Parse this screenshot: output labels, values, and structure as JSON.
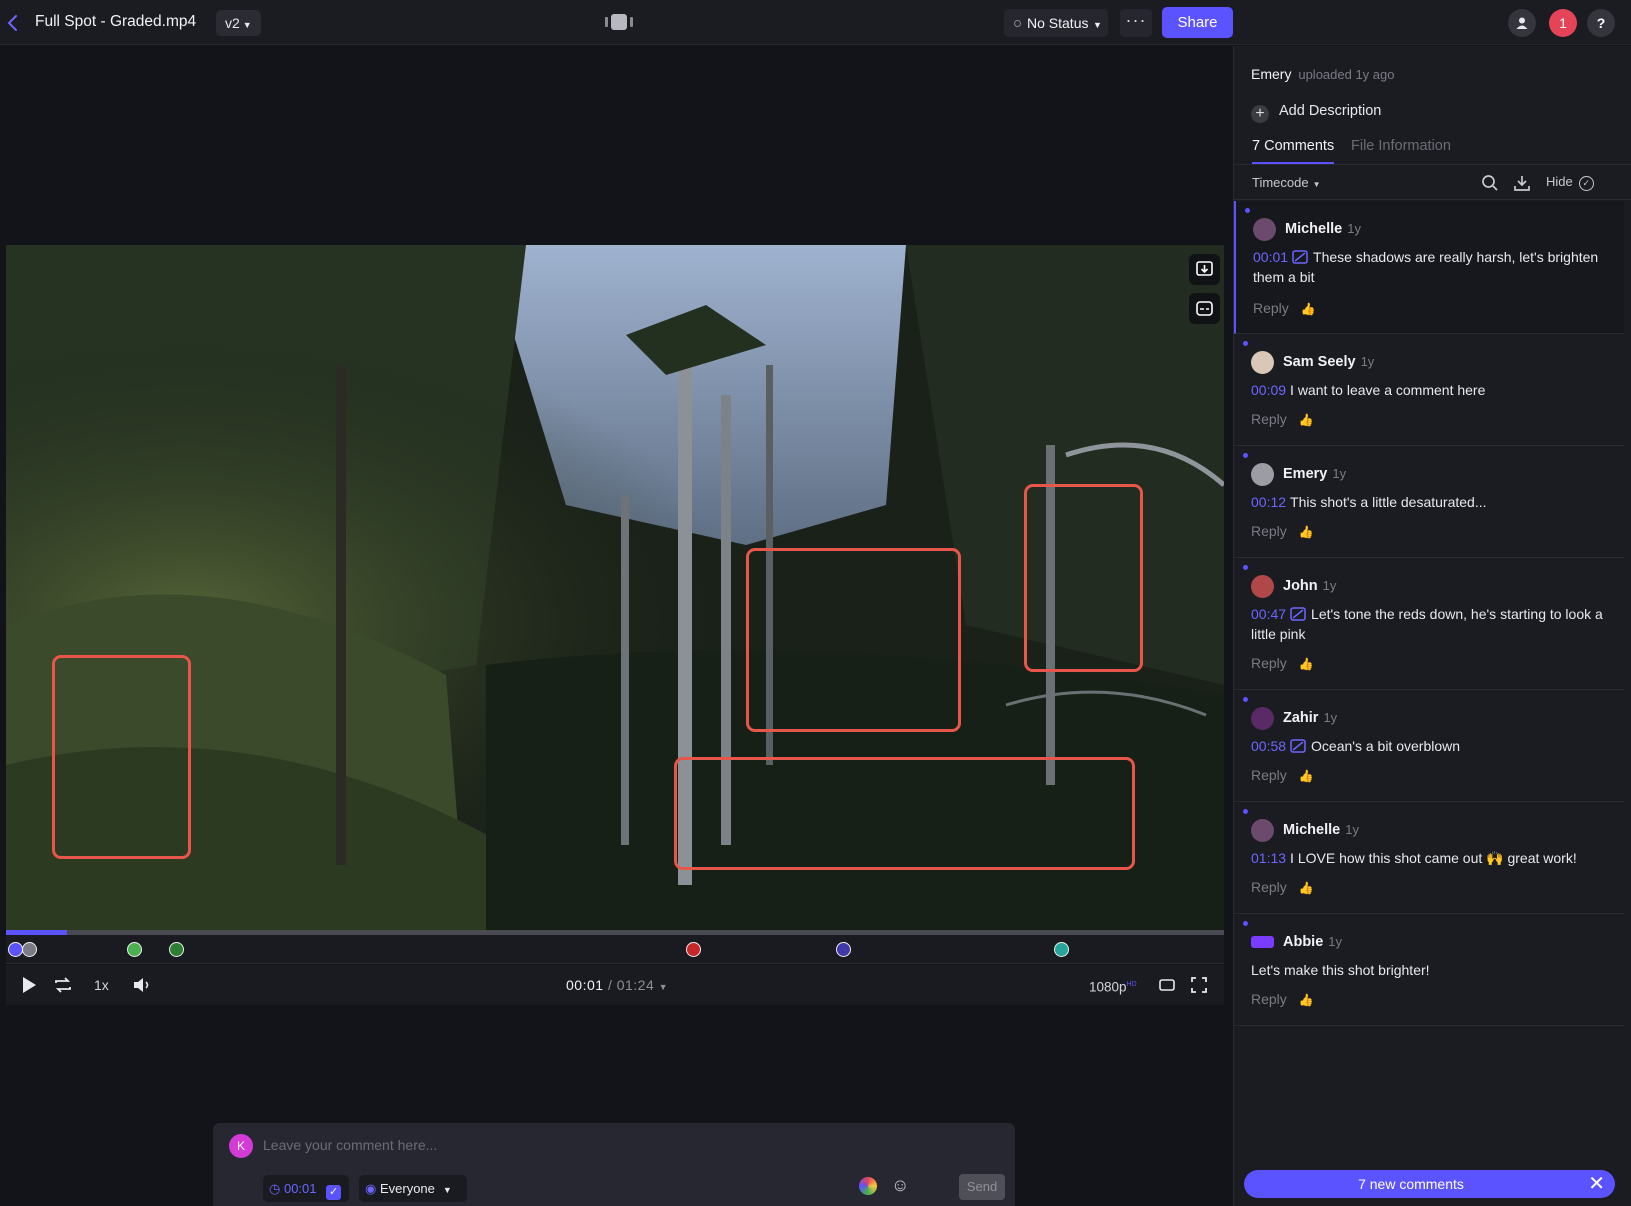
{
  "header": {
    "file_title": "Full Spot - Graded.mp4",
    "version": "v2",
    "status": "No Status",
    "more": "···",
    "share_label": "Share",
    "notification_count": "1",
    "help": "?"
  },
  "player": {
    "current_time": "00:01",
    "total_time": "/ 01:24",
    "speed": "1x",
    "quality": "1080p",
    "quality_badge": "HD",
    "progress_fraction": 0.05,
    "markers": [
      {
        "color": "#5b53ff"
      },
      {
        "color": "#7a7b84"
      },
      {
        "color": "#4caf50"
      },
      {
        "color": "#2e7d32"
      },
      {
        "color": "#c62828"
      },
      {
        "color": "#3f3aa8"
      },
      {
        "color": "#26a69a"
      }
    ]
  },
  "composer": {
    "avatar_letter": "K",
    "placeholder": "Leave your comment here...",
    "time": "00:01",
    "audience": "Everyone",
    "send_label": "Send"
  },
  "sidebar": {
    "uploader": "Emery",
    "upload_meta": "uploaded 1y ago",
    "add_description": "Add Description",
    "tab_comments": "7 Comments",
    "tab_info": "File Information",
    "sort_label": "Timecode",
    "hide_label": "Hide",
    "comments": [
      {
        "author": "Michelle",
        "age": "1y",
        "time": "00:01",
        "has_drawing": true,
        "text": "These shadows are really harsh, let's brighten them a bit",
        "reply": "Reply",
        "avatar_color": "#6b4a6e"
      },
      {
        "author": "Sam Seely",
        "age": "1y",
        "time": "00:09",
        "has_drawing": false,
        "text": "I want to leave a comment here",
        "reply": "Reply",
        "avatar_color": "#d9c7b8"
      },
      {
        "author": "Emery",
        "age": "1y",
        "time": "00:12",
        "has_drawing": false,
        "text": "This shot's a little desaturated...",
        "reply": "Reply",
        "avatar_color": "#9c9ca4"
      },
      {
        "author": "John",
        "age": "1y",
        "time": "00:47",
        "has_drawing": true,
        "text": "Let's tone the reds down, he's starting to look a little pink",
        "reply": "Reply",
        "avatar_color": "#b0484a"
      },
      {
        "author": "Zahir",
        "age": "1y",
        "time": "00:58",
        "has_drawing": true,
        "text": "Ocean's a bit overblown",
        "reply": "Reply",
        "avatar_color": "#5a2a66"
      },
      {
        "author": "Michelle",
        "age": "1y",
        "time": "01:13",
        "has_drawing": false,
        "text": "I LOVE how this shot came out 🙌 great work!",
        "reply": "Reply",
        "avatar_color": "#6b4a6e"
      },
      {
        "author": "Abbie",
        "age": "1y",
        "time": "",
        "has_drawing": false,
        "text": "Let's make this shot brighter!",
        "reply": "Reply",
        "avatar_color": "#7a3cff"
      }
    ],
    "new_comments_label": "7 new comments"
  },
  "colors": {
    "accent": "#5b53ff",
    "annotation": "#e7554b",
    "background": "#131419",
    "panel": "#1b1c22"
  }
}
